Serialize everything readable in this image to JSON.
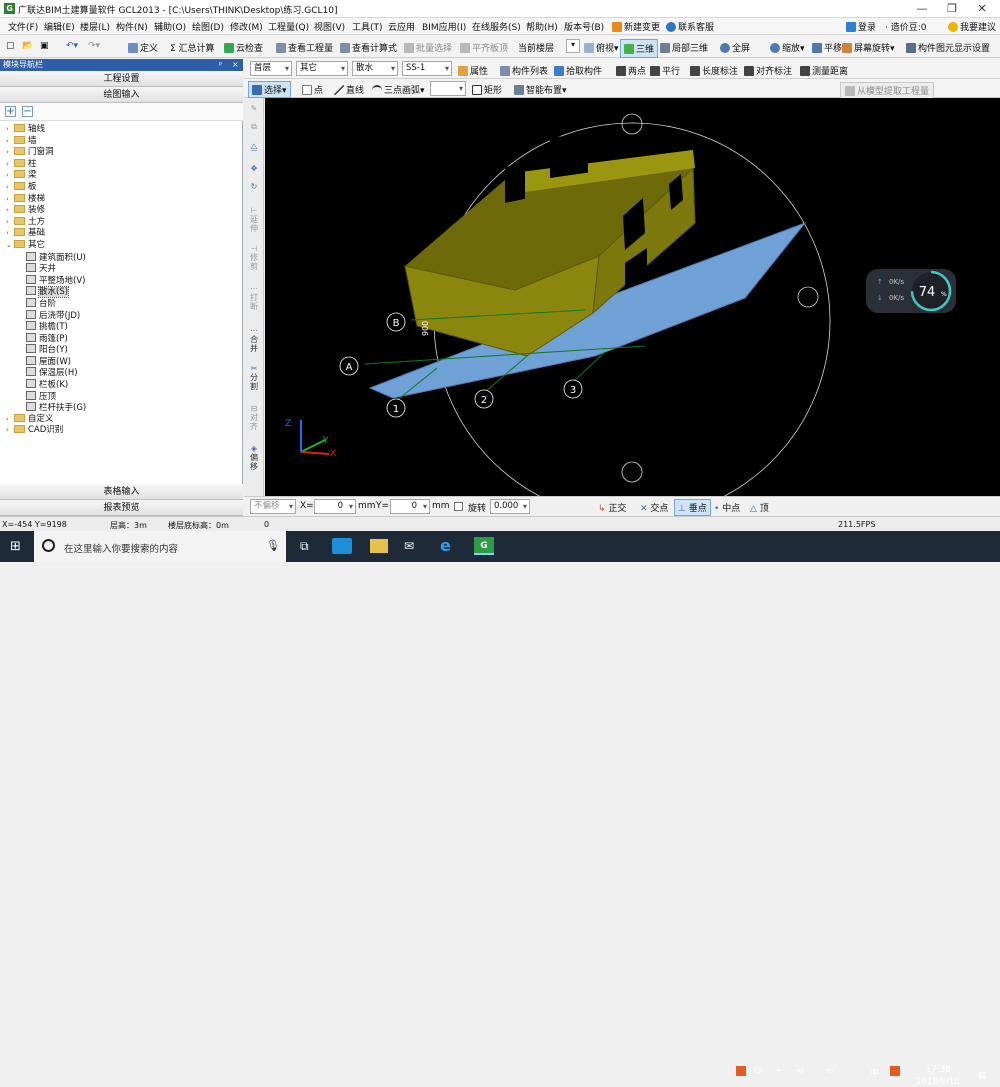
{
  "window": {
    "title": "广联达BIM土建算量软件 GCL2013 - [C:\\Users\\THINK\\Desktop\\练习.GCL10]",
    "controls": [
      "—",
      "❐",
      "✕"
    ]
  },
  "menu": [
    "文件(F)",
    "编辑(E)",
    "楼层(L)",
    "构件(N)",
    "辅助(O)",
    "绘图(D)",
    "修改(M)",
    "工程量(Q)",
    "视图(V)",
    "工具(T)",
    "云应用",
    "BIM应用(I)",
    "在线服务(S)",
    "帮助(H)",
    "版本号(B)",
    "新建变更",
    "联系客服"
  ],
  "menu_right": {
    "login": "登录",
    "cost_beans": "· 造价豆:0",
    "suggest": "我要建议"
  },
  "toolbar1": {
    "define": "定义",
    "sum": "Σ 汇总计算",
    "cloud_check": "云检查",
    "view_quantity": "查看工程量",
    "view_formula": "查看计算式",
    "batch_select": "批量选择",
    "align_slab": "平齐板顶",
    "current_floor": "当前楼层",
    "top_view": "俯视",
    "three_d": "三维",
    "local_3d": "局部三维",
    "fullscreen": "全屏",
    "zoom": "缩放",
    "pan": "平移",
    "rotate": "屏幕旋转",
    "display_settings": "构件图元显示设置"
  },
  "nav": {
    "header": "模块导航栏",
    "project_settings": "工程设置",
    "draw_input": "绘图输入",
    "table_input": "表格输入",
    "report_preview": "报表预览",
    "pin": "ᵖ",
    "close": "×"
  },
  "tree": [
    {
      "label": "轴线",
      "level": 0
    },
    {
      "label": "墙",
      "level": 0
    },
    {
      "label": "门窗洞",
      "level": 0
    },
    {
      "label": "柱",
      "level": 0
    },
    {
      "label": "梁",
      "level": 0
    },
    {
      "label": "板",
      "level": 0
    },
    {
      "label": "楼梯",
      "level": 0
    },
    {
      "label": "装修",
      "level": 0
    },
    {
      "label": "土方",
      "level": 0
    },
    {
      "label": "基础",
      "level": 0
    },
    {
      "label": "其它",
      "level": 0,
      "open": true
    },
    {
      "label": "建筑面积(U)",
      "level": 1
    },
    {
      "label": "天井",
      "level": 1
    },
    {
      "label": "平整场地(V)",
      "level": 1
    },
    {
      "label": "散水(S)",
      "level": 1,
      "selected": true
    },
    {
      "label": "台阶",
      "level": 1
    },
    {
      "label": "后浇带(JD)",
      "level": 1
    },
    {
      "label": "挑檐(T)",
      "level": 1
    },
    {
      "label": "雨篷(P)",
      "level": 1
    },
    {
      "label": "阳台(Y)",
      "level": 1
    },
    {
      "label": "屋面(W)",
      "level": 1
    },
    {
      "label": "保温层(H)",
      "level": 1
    },
    {
      "label": "栏板(K)",
      "level": 1
    },
    {
      "label": "压顶",
      "level": 1
    },
    {
      "label": "栏杆扶手(G)",
      "level": 1
    },
    {
      "label": "自定义",
      "level": 0
    },
    {
      "label": "CAD识别",
      "level": 0
    }
  ],
  "toolbar2": {
    "floor": "首层",
    "category": "其它",
    "component_type": "散水",
    "component": "SS-1",
    "property": "属性",
    "component_list": "构件列表",
    "pick": "拾取构件",
    "two_points": "两点",
    "parallel": "平行",
    "length_mark": "长度标注",
    "align_mark": "对齐标注",
    "measure": "测量距离"
  },
  "toolbar3": {
    "select": "选择",
    "point": "点",
    "line": "直线",
    "arc": "三点画弧",
    "rect": "矩形",
    "smart_layout": "智能布置",
    "extract": "从模型提取工程量"
  },
  "vtools": [
    "延伸",
    "修剪",
    "打断",
    "合并",
    "分割",
    "对齐",
    "偏移"
  ],
  "axis_labels": {
    "rows": [
      "A",
      "B"
    ],
    "cols": [
      "1",
      "2",
      "3"
    ],
    "dim": "900"
  },
  "speed_widget": {
    "up": "0K/s",
    "down": "0K/s",
    "percent": "74",
    "unit": "%"
  },
  "coordbar": {
    "no_offset": "不偏移",
    "x_label": "X=",
    "x_val": "0",
    "unit": "mm",
    "y_label": "Y=",
    "y_val": "0",
    "rotate": "旋转",
    "rotate_val": "0.000",
    "ortho": "正交",
    "intersect": "交点",
    "perp": "垂点",
    "mid": "中点",
    "more": "顶"
  },
  "status": {
    "coords": "X=-454 Y=9198",
    "floor_h": "层高：3m",
    "base_elev": "楼层底标高：0m",
    "value": "0",
    "right": "211.5FPS"
  },
  "taskbar": {
    "search": "在这里输入你要搜索的内容",
    "ime": "中",
    "time": "17:38",
    "date": "2018/9/10"
  },
  "colors": {
    "wall": "#7f7a0c",
    "slab": "#6fa0d6",
    "grid": "#ffffff",
    "axis": "#0f7a1f"
  }
}
